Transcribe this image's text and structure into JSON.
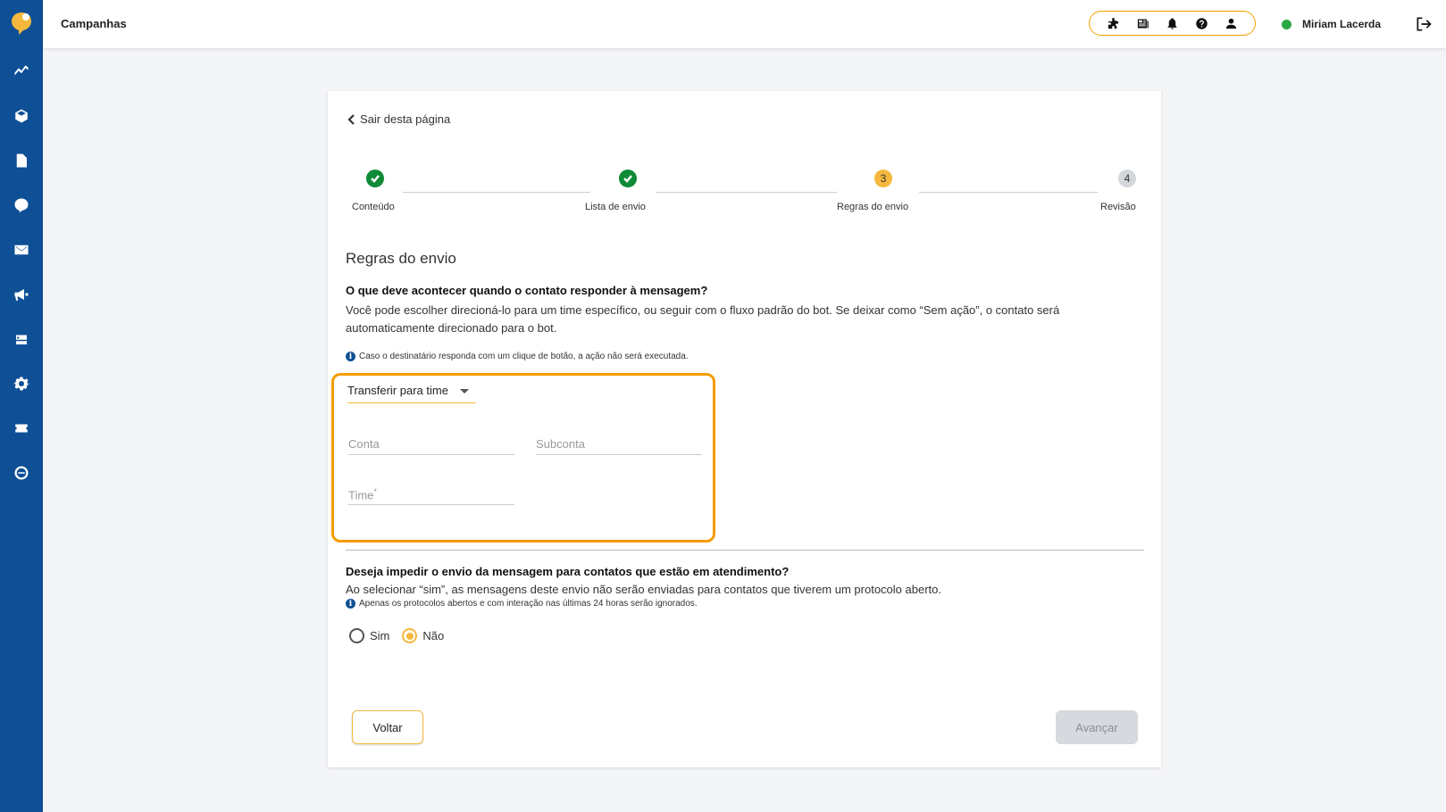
{
  "header": {
    "title": "Campanhas",
    "user_name": "Miriam Lacerda",
    "user_status_color": "#2aa842",
    "tools": [
      "puzzle-icon",
      "news-icon",
      "bell-icon",
      "help-icon",
      "user-icon"
    ]
  },
  "sidebar": {
    "items": [
      "analytics-icon",
      "cube-icon",
      "document-icon",
      "chat-logo-icon",
      "mail-icon",
      "megaphone-icon",
      "robot-icon",
      "gear-icon",
      "ticket-icon",
      "nps-icon"
    ]
  },
  "page": {
    "back_link": "Sair desta página",
    "steps": [
      {
        "label": "Conteúdo",
        "state": "done",
        "number": "1"
      },
      {
        "label": "Lista de envio",
        "state": "done",
        "number": "2"
      },
      {
        "label": "Regras do envio",
        "state": "current",
        "number": "3"
      },
      {
        "label": "Revisão",
        "state": "pending",
        "number": "4"
      }
    ],
    "section_title": "Regras do envio",
    "q1_title": "O que deve acontecer quando o contato responder à mensagem?",
    "q1_desc": "Você pode escolher direcioná-lo para um time específico, ou seguir com o fluxo padrão do bot. Se deixar como “Sem ação”, o contato será automaticamente direcionado para o bot.",
    "q1_info": "Caso o destinatário responda com um clique de botão, a ação não será executada.",
    "action_select": "Transferir para time",
    "field_conta": "Conta",
    "field_subconta": "Subconta",
    "field_time": "Time",
    "required_mark": "*",
    "q2_title": "Deseja impedir o envio da mensagem para contatos que estão em atendimento?",
    "q2_desc": "Ao selecionar “sim”, as mensagens deste envio não serão enviadas para contatos que tiverem um protocolo aberto.",
    "q2_info": "Apenas os protocolos abertos e com interação nas últimas 24 horas serão ignorados.",
    "radio_yes": "Sim",
    "radio_no": "Não",
    "radio_selected": "Não",
    "btn_back": "Voltar",
    "btn_next": "Avançar"
  },
  "colors": {
    "sidebar": "#0e4f96",
    "accent": "#f5b83c",
    "highlight": "#f59c00",
    "done": "#0f8a37"
  }
}
